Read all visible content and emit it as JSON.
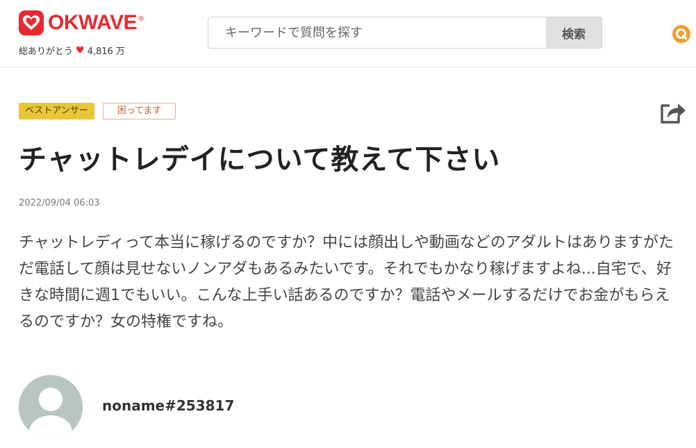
{
  "header": {
    "logo_text": "OKWAVE",
    "logo_reg": "®",
    "thanks_label": "総ありがとう",
    "thanks_heart": "♥",
    "thanks_count": "4,816 万",
    "search_placeholder": "キーワードで質問を探す",
    "search_value": "",
    "search_button": "検索"
  },
  "question": {
    "tags": [
      "ベストアンサー",
      "困ってます"
    ],
    "title": "チャットレデイについて教えて下さい",
    "date": "2022/09/04 06:03",
    "body": "チャットレディって本当に稼げるのですか？中には顔出しや動画などのアダルトはありますがただ電話して顔は見せないノンアダもあるみたいです。それでもかなり稼げますよね...自宅で、好きな時間に週1でもいい。こんな上手い話あるのですか？電話やメールするだけでお金がもらえるのですか？女の特権ですね。"
  },
  "author": {
    "name": "noname#253817"
  },
  "colors": {
    "brand": "#e8292f",
    "best_tag_bg": "#e8c63a",
    "trouble_tag": "#c8622a",
    "q_icon": "#f0a030"
  },
  "icons": {
    "logo": "heart-logo-icon",
    "q": "q-search-icon",
    "share": "share-icon",
    "avatar": "default-avatar-icon"
  }
}
